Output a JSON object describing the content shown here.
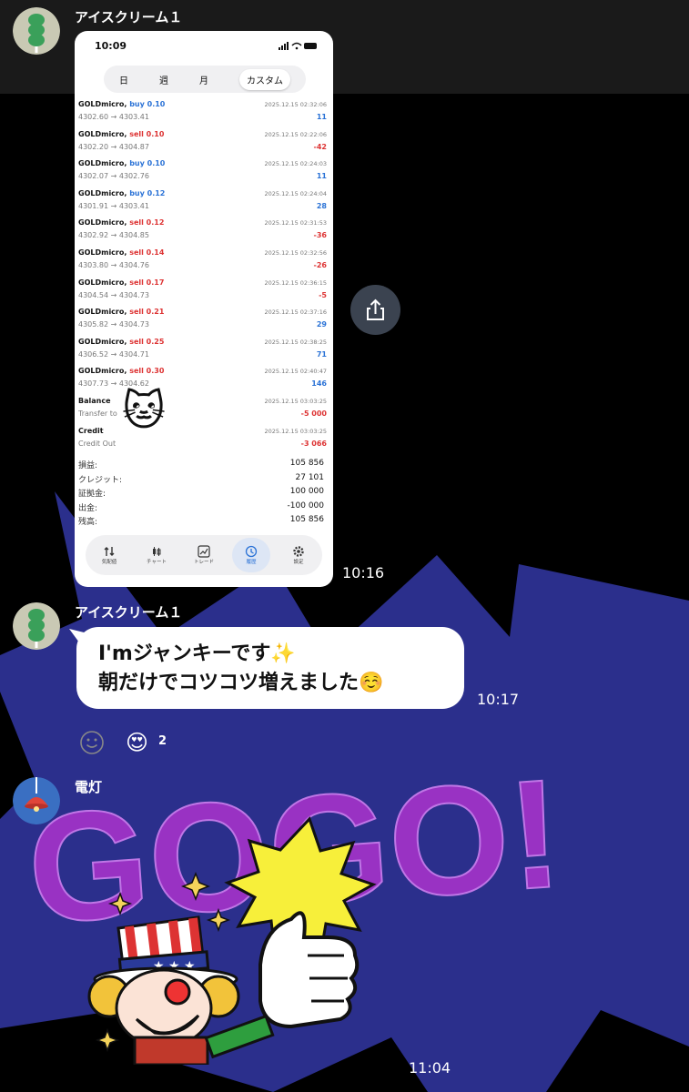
{
  "colors": {
    "bg": "#000000",
    "bubble": "#ffffff",
    "buy": "#2a72d6",
    "sell": "#d33333",
    "burst_blue": "#2b2f8c",
    "gogo_purple": "#b13bd8"
  },
  "background_text": "GOGO!",
  "messages": [
    {
      "sender": "アイスクリーム１",
      "avatar_icon": "green-dango-icon",
      "time": "10:16",
      "type": "image"
    },
    {
      "sender": "アイスクリーム１",
      "avatar_icon": "green-dango-icon",
      "time": "10:17",
      "type": "text",
      "lines": [
        "I'mジャンキーです✨",
        "朝だけでコツコツ増えました☺️"
      ],
      "reactions": {
        "add_icon": "smiley-add-icon",
        "emoji": "😍",
        "count": "2"
      }
    },
    {
      "sender": "電灯",
      "avatar_icon": "lamp-icon",
      "time": "11:04",
      "type": "sticker",
      "sticker_icon": "clown-thumbs-up-sticker"
    }
  ],
  "screenshot": {
    "clock": "10:09",
    "segments": [
      "日",
      "週",
      "月",
      "カスタム"
    ],
    "trades": [
      {
        "sym": "GOLDmicro,",
        "side": "buy 0.10",
        "cls": "buy",
        "px": "4302.60 → 4303.41",
        "dt": "2025.12.15 02:32:06",
        "pl": "11",
        "plcls": "buy"
      },
      {
        "sym": "GOLDmicro,",
        "side": "sell 0.10",
        "cls": "sell",
        "px": "4302.20 → 4304.87",
        "dt": "2025.12.15 02:22:06",
        "pl": "-42",
        "plcls": "sell"
      },
      {
        "sym": "GOLDmicro,",
        "side": "buy 0.10",
        "cls": "buy",
        "px": "4302.07 → 4302.76",
        "dt": "2025.12.15 02:24:03",
        "pl": "11",
        "plcls": "buy"
      },
      {
        "sym": "GOLDmicro,",
        "side": "buy 0.12",
        "cls": "buy",
        "px": "4301.91 → 4303.41",
        "dt": "2025.12.15 02:24:04",
        "pl": "28",
        "plcls": "buy"
      },
      {
        "sym": "GOLDmicro,",
        "side": "sell 0.12",
        "cls": "sell",
        "px": "4302.92 → 4304.85",
        "dt": "2025.12.15 02:31:53",
        "pl": "-36",
        "plcls": "sell"
      },
      {
        "sym": "GOLDmicro,",
        "side": "sell 0.14",
        "cls": "sell",
        "px": "4303.80 → 4304.76",
        "dt": "2025.12.15 02:32:56",
        "pl": "-26",
        "plcls": "sell"
      },
      {
        "sym": "GOLDmicro,",
        "side": "sell 0.17",
        "cls": "sell",
        "px": "4304.54 → 4304.73",
        "dt": "2025.12.15 02:36:15",
        "pl": "-5",
        "plcls": "sell"
      },
      {
        "sym": "GOLDmicro,",
        "side": "sell 0.21",
        "cls": "sell",
        "px": "4305.82 → 4304.73",
        "dt": "2025.12.15 02:37:16",
        "pl": "29",
        "plcls": "buy"
      },
      {
        "sym": "GOLDmicro,",
        "side": "sell 0.25",
        "cls": "sell",
        "px": "4306.52 → 4304.71",
        "dt": "2025.12.15 02:38:25",
        "pl": "71",
        "plcls": "buy"
      },
      {
        "sym": "GOLDmicro,",
        "side": "sell 0.30",
        "cls": "sell",
        "px": "4307.73 → 4304.62",
        "dt": "2025.12.15 02:40:47",
        "pl": "146",
        "plcls": "buy"
      }
    ],
    "balance": {
      "label": "Balance",
      "sub": "Transfer to",
      "dt": "2025.12.15 03:03:25",
      "val": "-5 000"
    },
    "credit": {
      "label": "Credit",
      "sub": "Credit Out",
      "dt": "2025.12.15 03:03:25",
      "val": "-3 066"
    },
    "summary": [
      {
        "k": "損益:",
        "v": "105 856"
      },
      {
        "k": "クレジット:",
        "v": "27 101"
      },
      {
        "k": "証拠金:",
        "v": "100 000"
      },
      {
        "k": "出金:",
        "v": "-100 000"
      },
      {
        "k": "残高:",
        "v": "105 856"
      }
    ],
    "tabs": [
      {
        "label": "気配値",
        "icon": "quotes-icon"
      },
      {
        "label": "チャート",
        "icon": "chart-icon"
      },
      {
        "label": "トレード",
        "icon": "trade-icon"
      },
      {
        "label": "履歴",
        "icon": "history-icon",
        "active": true
      },
      {
        "label": "設定",
        "icon": "settings-icon"
      }
    ],
    "cat_emoji": "🐱"
  }
}
